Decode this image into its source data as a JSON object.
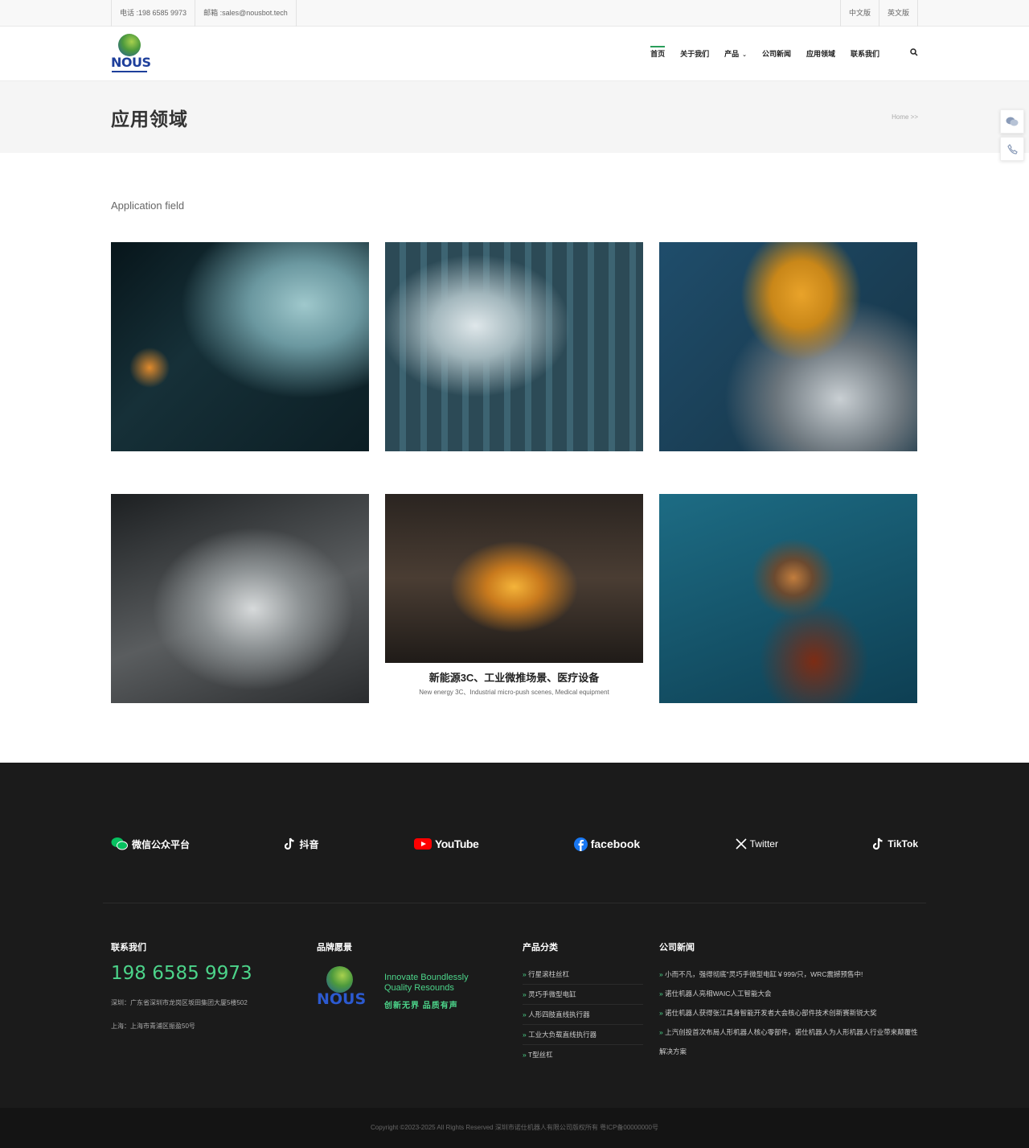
{
  "topbar": {
    "phone": "电话 :198 6585 9973",
    "email": "邮箱 :sales@nousbot.tech",
    "lang_cn": "中文版",
    "lang_en": "英文版"
  },
  "header": {
    "logo_text": "NOUS",
    "nav": [
      {
        "label": "首页",
        "active": true
      },
      {
        "label": "关于我们"
      },
      {
        "label": "产品",
        "dropdown": true
      },
      {
        "label": "公司新闻"
      },
      {
        "label": "应用领域"
      },
      {
        "label": "联系我们"
      }
    ],
    "search_icon": "search-icon"
  },
  "pagehead": {
    "title": "应用领域",
    "breadcrumb": "Home >>"
  },
  "sidefloat": {
    "icons": [
      "wechat-icon",
      "phone-icon"
    ]
  },
  "main": {
    "subtitle": "Application field",
    "cards": [
      {
        "image": "robotic-hand-photo"
      },
      {
        "image": "humanoid-robots-assembly-line-photo"
      },
      {
        "image": "industrial-robot-arm-engine-photo"
      },
      {
        "image": "transparent-car-chassis-photo"
      },
      {
        "image": "precision-dispensing-machine-photo",
        "caption_cn": "新能源3C、工业微推场景、医疗设备",
        "caption_en": "New energy 3C、Industrial micro-push scenes, Medical equipment"
      },
      {
        "image": "offshore-oil-platform-photo"
      }
    ]
  },
  "footer": {
    "social": [
      {
        "label": "微信公众平台",
        "icon": "wechat-icon",
        "color": "#07c160"
      },
      {
        "label": "抖音",
        "icon": "douyin-icon",
        "color": "#ffffff"
      },
      {
        "label": "YouTube",
        "icon": "youtube-icon",
        "color": "#ff0000"
      },
      {
        "label": "facebook",
        "icon": "facebook-icon",
        "color": "#1877f2"
      },
      {
        "label": "Twitter",
        "icon": "x-twitter-icon",
        "color": "#ffffff"
      },
      {
        "label": "TikTok",
        "icon": "tiktok-icon",
        "color": "#ffffff"
      }
    ],
    "contact": {
      "heading": "联系我们",
      "phone": "198 6585 9973",
      "addr1": "深圳：广东省深圳市龙岗区坂田集团大厦5楼502",
      "addr2": "上海：上海市青浦区振盈50号"
    },
    "brand": {
      "heading": "品牌愿景",
      "logo_text": "NOUS",
      "slogan_en_1": "Innovate Boundlessly",
      "slogan_en_2": "Quality Resounds",
      "slogan_cn": "创新无界 品质有声"
    },
    "products": {
      "heading": "产品分类",
      "items": [
        "行星滚柱丝杠",
        "灵巧手微型电缸",
        "人形四肢直线执行器",
        "工业大负载直线执行器",
        "T型丝杠"
      ]
    },
    "news": {
      "heading": "公司新闻",
      "items": [
        "小而不凡，强得彻底\"灵巧手微型电缸￥999/只，WRC震撼预售中!",
        "诺仕机器人亮相WAIC人工智能大会",
        "诺仕机器人获得张江具身智能开发者大会核心部件技术创新赛新锐大奖",
        "上汽创投首次布局人形机器人核心零部件，诺仕机器人为人形机器人行业带来颠覆性解决方案"
      ]
    },
    "copyright": "Copyright ©2023-2025 All Rights Reserved 深圳市诺仕机器人有限公司版权所有 粤ICP备00000000号"
  },
  "colors": {
    "accent": "#4cd48a",
    "footer_bg": "#1b1b1b",
    "nav_active": "#2a9d5a"
  }
}
